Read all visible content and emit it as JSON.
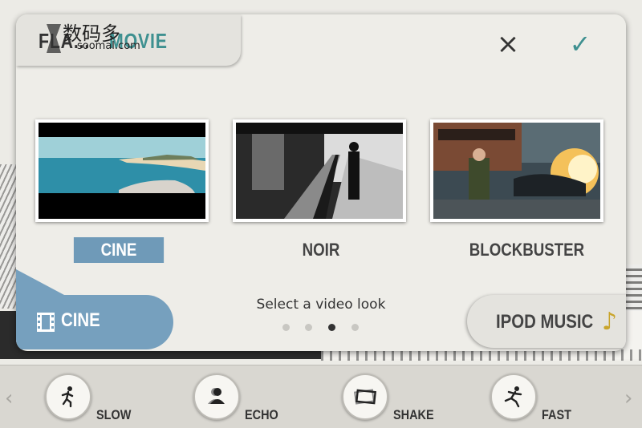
{
  "watermark": {
    "main": "数码多",
    "sub": "soomal.com"
  },
  "header": {
    "title_part1": "FLA...",
    "title_part2": "MOVIE",
    "close_icon": "×",
    "confirm_icon": "✓"
  },
  "looks": [
    {
      "label": "CINE",
      "selected": true,
      "thumbnail": "beach-scene"
    },
    {
      "label": "NOIR",
      "selected": false,
      "thumbnail": "train-station"
    },
    {
      "label": "BLOCKBUSTER",
      "selected": false,
      "thumbnail": "explosion-street"
    }
  ],
  "current_look": {
    "icon": "film-icon",
    "label": "CINE"
  },
  "prompt": "Select a video look",
  "pagination": {
    "count": 4,
    "active": 3
  },
  "music_button": {
    "label": "IPOD MUSIC",
    "icon": "♪"
  },
  "effects": [
    {
      "label": "SLOW",
      "icon": "runner-slow-icon"
    },
    {
      "label": "ECHO",
      "icon": "echo-person-icon"
    },
    {
      "label": "SHAKE",
      "icon": "shake-frame-icon"
    },
    {
      "label": "FAST",
      "icon": "runner-fast-icon"
    }
  ],
  "nav": {
    "prev_icon": "‹",
    "next_icon": "›"
  },
  "colors": {
    "accent_teal": "#3e9090",
    "accent_blue": "#76a0be",
    "music_note": "#c9a52c"
  }
}
